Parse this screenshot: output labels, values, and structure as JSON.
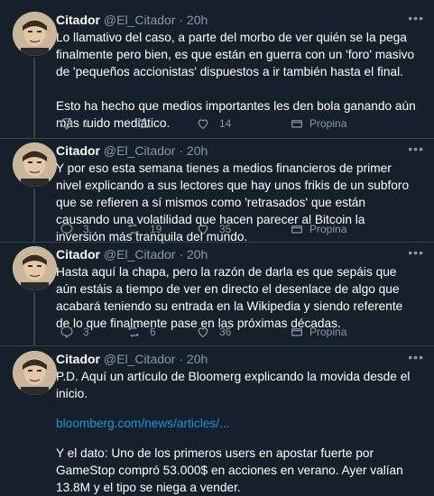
{
  "tweets": [
    {
      "name": "Citador",
      "handle": "@El_Citador",
      "time": "20h",
      "text": "Lo llamativo del caso, a parte del morbo de ver quién se la pega finalmente pero bien, es que están en guerra con un 'foro' masivo de 'pequeños accionistas' dispuestos a ir también hasta el final.\n\nEsto ha hecho que medios importantes les den bola ganando aún más ruido mediático.",
      "replies": "1",
      "retweets": "",
      "likes": "14",
      "promo": "Propina"
    },
    {
      "name": "Citador",
      "handle": "@El_Citador",
      "time": "20h",
      "text": "Y por eso esta semana tienes a medios financieros de primer nivel explicando a sus lectores que hay unos frikis de un subforo que se refieren a sí mismos como 'retrasados' que están causando una volatilidad que hacen parecer al Bitcoin la inversión más tranquila del mundo.",
      "replies": "3",
      "retweets": "19",
      "likes": "35",
      "promo": "Propina"
    },
    {
      "name": "Citador",
      "handle": "@El_Citador",
      "time": "20h",
      "text": "Hasta aquí la chapa, pero la razón de darla es que sepáis que aún estáis a tiempo de ver en directo el desenlace de algo que acabará teniendo su entrada en la Wikipedia y siendo referente de lo que finalmente pase en las próximas décadas.",
      "replies": "3",
      "retweets": "6",
      "likes": "36",
      "promo": "Propina"
    },
    {
      "name": "Citador",
      "handle": "@El_Citador",
      "time": "20h",
      "text": "P.D. Aquí un artículo de Bloomerg explicando la movida desde el inicio.",
      "link": "bloomberg.com/news/articles/...",
      "text2": "Y el dato: Uno de los primeros users en apostar fuerte por GameStop compró 53.000$ en acciones en verano. Ayer valían 13.8M y el tipo se niega a vender."
    }
  ],
  "icons": {
    "reply": "reply-icon",
    "retweet": "retweet-icon",
    "like": "heart-icon",
    "promo": "tip-icon",
    "more": "more-icon"
  },
  "colors": {
    "background": "#15202b",
    "secondary_text": "#8899a6",
    "link": "#1b95e0",
    "divider": "#38444d"
  }
}
